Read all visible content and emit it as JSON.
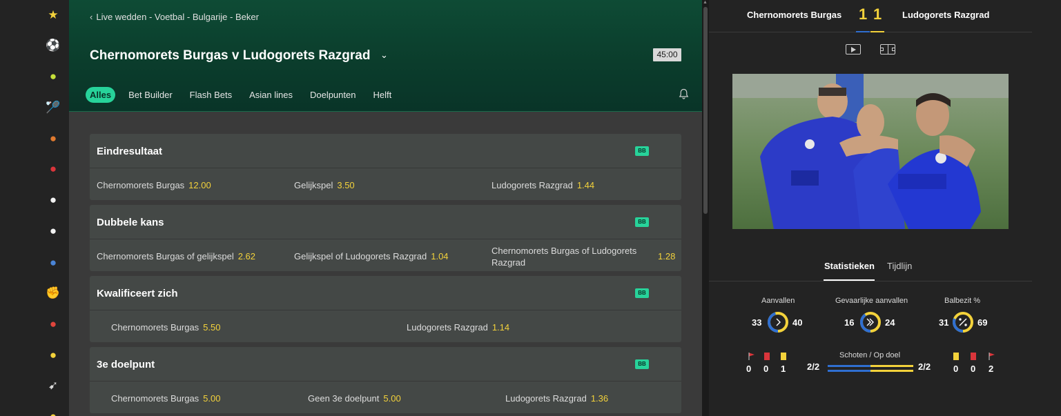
{
  "sidebar": {
    "icons": [
      {
        "name": "favorites-star-icon",
        "glyph": "★",
        "color": "#f3d23b"
      },
      {
        "name": "football-icon",
        "glyph": "⚽",
        "color": "#ffffff"
      },
      {
        "name": "tennis-icon",
        "glyph": "●",
        "color": "#c6e03a"
      },
      {
        "name": "badminton-icon",
        "glyph": "🏸",
        "color": "#ffffff"
      },
      {
        "name": "basketball-icon",
        "glyph": "●",
        "color": "#e07a2f"
      },
      {
        "name": "cricket-icon",
        "glyph": "●",
        "color": "#d9353b"
      },
      {
        "name": "golf-icon",
        "glyph": "●",
        "color": "#f2f2f2"
      },
      {
        "name": "baseball-icon",
        "glyph": "●",
        "color": "#f2f2f2"
      },
      {
        "name": "bowls-icon",
        "glyph": "●",
        "color": "#4a84d6"
      },
      {
        "name": "boxing-icon",
        "glyph": "✊",
        "color": "#f0c49a"
      },
      {
        "name": "table-tennis-icon",
        "glyph": "●",
        "color": "#e0453c"
      },
      {
        "name": "volleyball-icon",
        "glyph": "●",
        "color": "#f3d23b"
      },
      {
        "name": "darts-icon",
        "glyph": "➹",
        "color": "#dcdcdc"
      },
      {
        "name": "more-sports-icon",
        "glyph": "●",
        "color": "#f3d23b"
      }
    ]
  },
  "header": {
    "breadcrumb": "Live wedden - Voetbal - Bulgarije - Beker",
    "match_title": "Chernomorets Burgas v Ludogorets Razgrad",
    "clock": "45:00",
    "tabs": [
      "Alles",
      "Bet Builder",
      "Flash Bets",
      "Asian lines",
      "Doelpunten",
      "Helft"
    ]
  },
  "markets": [
    {
      "title": "Eindresultaat",
      "badge": "BB",
      "selections": [
        {
          "label": "Chernomorets Burgas",
          "odd": "12.00"
        },
        {
          "label": "Gelijkspel",
          "odd": "3.50"
        },
        {
          "label": "Ludogorets Razgrad",
          "odd": "1.44"
        }
      ]
    },
    {
      "title": "Dubbele kans",
      "badge": "BB",
      "selections": [
        {
          "label": "Chernomorets Burgas of gelijkspel",
          "odd": "2.62"
        },
        {
          "label": "Gelijkspel of Ludogorets Razgrad",
          "odd": "1.04"
        },
        {
          "label": "Chernomorets Burgas of Ludogorets Razgrad",
          "odd": "1.28"
        }
      ]
    },
    {
      "title": "Kwalificeert zich",
      "badge": "BB",
      "selections": [
        {
          "label": "Chernomorets Burgas",
          "odd": "5.50"
        },
        {
          "label": "Ludogorets Razgrad",
          "odd": "1.14"
        }
      ]
    },
    {
      "title": "3e doelpunt",
      "badge": "BB",
      "selections": [
        {
          "label": "Chernomorets Burgas",
          "odd": "5.00"
        },
        {
          "label": "Geen 3e doelpunt",
          "odd": "5.00"
        },
        {
          "label": "Ludogorets Razgrad",
          "odd": "1.36"
        }
      ]
    }
  ],
  "scoreboard": {
    "home_team": "Chernomorets Burgas",
    "away_team": "Ludogorets Razgrad",
    "home_score": "1",
    "away_score": "1",
    "home_color": "#2f6fd1",
    "away_color": "#f3d23b"
  },
  "stats": {
    "tabs": [
      "Statistieken",
      "Tijdlijn"
    ],
    "attacks": {
      "label": "Aanvallen",
      "home": "33",
      "away": "40",
      "home_share": 0.452
    },
    "dangerous_attacks": {
      "label": "Gevaarlijke aanvallen",
      "home": "16",
      "away": "24",
      "home_share": 0.4
    },
    "possession": {
      "label": "Balbezit %",
      "home": "31",
      "away": "69",
      "home_share": 0.31
    },
    "home_corners": "0",
    "home_red_cards": "0",
    "home_yellow_cards": "1",
    "away_yellow_cards": "0",
    "away_red_cards": "0",
    "away_corners": "2",
    "shots_label": "Schoten / Op doel",
    "home_shots": "2/2",
    "away_shots": "2/2"
  }
}
